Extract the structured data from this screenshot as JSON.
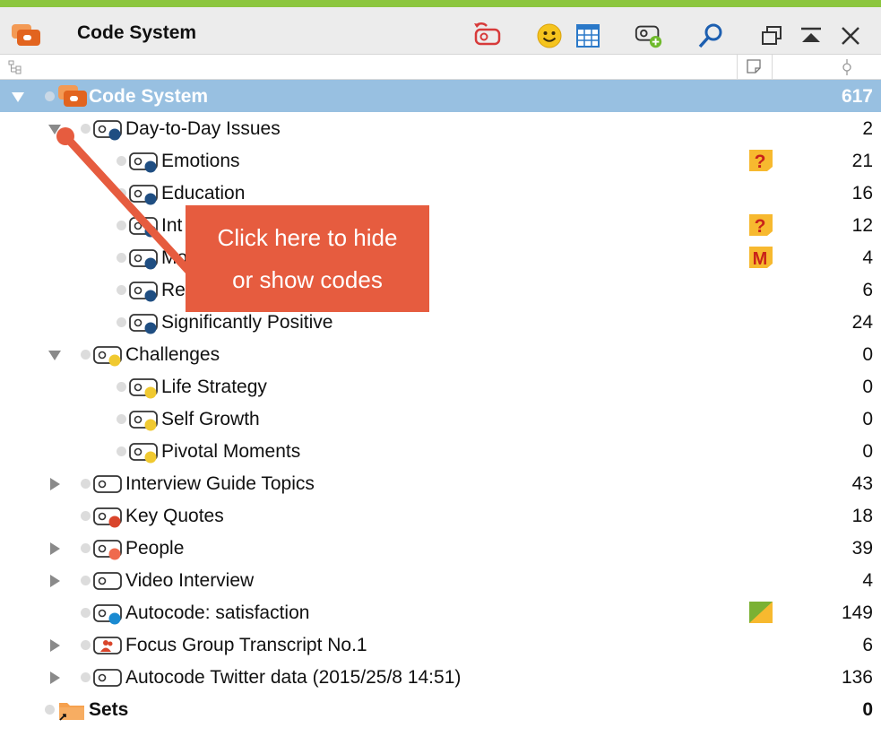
{
  "window": {
    "title": "Code System",
    "accent_color": "#8cc63e",
    "toolbar_icons": [
      "reset-activation-icon",
      "emoticon-icon",
      "grid-table-icon",
      "new-code-icon",
      "search-icon",
      "undock-window-icon",
      "collapse-window-icon",
      "close-icon"
    ]
  },
  "header": {
    "columns": [
      "tree-structure-icon",
      "memo-column-icon",
      "activation-column-icon"
    ]
  },
  "tree": {
    "root": {
      "label": "Code System",
      "count": "617",
      "bg_color": "#98c0e1"
    },
    "rows": [
      {
        "label": "Day-to-Day Issues",
        "count": "2",
        "level": 1,
        "expander": "expanded",
        "color": "#1f4e82"
      },
      {
        "label": "Emotions",
        "count": "21",
        "level": 2,
        "color": "#1f4e82",
        "memo": "question"
      },
      {
        "label": "Education",
        "count": "16",
        "level": 2,
        "color": "#1f4e82"
      },
      {
        "label": "Int",
        "count": "12",
        "level": 2,
        "color": "#1f4e82",
        "memo": "question"
      },
      {
        "label": "Mo",
        "count": "4",
        "level": 2,
        "color": "#1f4e82",
        "memo": "M"
      },
      {
        "label": "Re",
        "count": "6",
        "level": 2,
        "color": "#1f4e82"
      },
      {
        "label": "Significantly Positive",
        "count": "24",
        "level": 2,
        "color": "#1f4e82"
      },
      {
        "label": "Challenges",
        "count": "0",
        "level": 1,
        "expander": "expanded",
        "color": "#f0c930"
      },
      {
        "label": "Life Strategy",
        "count": "0",
        "level": 2,
        "color": "#f0c930"
      },
      {
        "label": "Self Growth",
        "count": "0",
        "level": 2,
        "color": "#f0c930"
      },
      {
        "label": "Pivotal Moments",
        "count": "0",
        "level": 2,
        "color": "#f0c930"
      },
      {
        "label": "Interview Guide Topics",
        "count": "43",
        "level": 1,
        "expander": "collapsed",
        "color": ""
      },
      {
        "label": "Key Quotes",
        "count": "18",
        "level": 1,
        "color": "#d9452b"
      },
      {
        "label": "People",
        "count": "39",
        "level": 1,
        "expander": "collapsed",
        "color": "#ef6a4d"
      },
      {
        "label": "Video Interview",
        "count": "4",
        "level": 1,
        "expander": "collapsed",
        "color": ""
      },
      {
        "label": "Autocode: satisfaction",
        "count": "149",
        "level": 1,
        "color": "#1a8ad1",
        "memo": "green"
      },
      {
        "label": "Focus Group Transcript No.1",
        "count": "6",
        "level": 1,
        "expander": "collapsed",
        "color": "",
        "icon": "focus-group"
      },
      {
        "label": "Autocode Twitter data (2015/25/8 14:51)",
        "count": "136",
        "level": 1,
        "expander": "collapsed",
        "color": ""
      }
    ],
    "sets": {
      "label": "Sets",
      "count": "0"
    }
  },
  "callout": {
    "lines": [
      "Click here to hide",
      "or show codes"
    ],
    "color": "#e65c3f"
  }
}
